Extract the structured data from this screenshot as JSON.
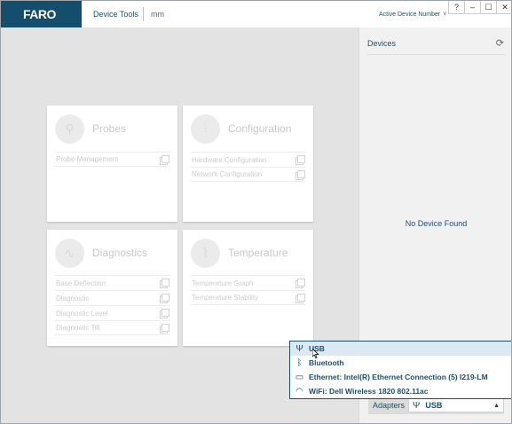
{
  "header": {
    "logo_text": "FARO",
    "nav_tools": "Device Tools",
    "nav_unit": "mm",
    "active_device_label": "Active Device Number",
    "window_buttons": [
      "?",
      "–",
      "☐",
      "✕"
    ]
  },
  "cards": [
    {
      "title": "Probes",
      "icon": "probe-icon",
      "items": [
        "Probe Management"
      ]
    },
    {
      "title": "Configuration",
      "icon": "sliders-icon",
      "items": [
        "Hardware Configuration",
        "Network Configuration"
      ]
    },
    {
      "title": "Diagnostics",
      "icon": "pulse-icon",
      "items": [
        "Base Deflection",
        "Diagnostic",
        "Diagnostic Level",
        "Diagnostic Tilt"
      ]
    },
    {
      "title": "Temperature",
      "icon": "thermometer-icon",
      "items": [
        "Temperature Graph",
        "Temperature Stability"
      ]
    }
  ],
  "devices": {
    "title": "Devices",
    "empty_text": "No Device Found",
    "adapters_label": "Adapters",
    "adapter_selected": "USB"
  },
  "adapter_options": [
    {
      "label": "USB",
      "icon": "usb-icon",
      "selected": true
    },
    {
      "label": "Bluetooth",
      "icon": "bluetooth-icon",
      "selected": false
    },
    {
      "label": "Ethernet: Intel(R) Ethernet Connection (5) I219-LM",
      "icon": "ethernet-icon",
      "selected": false
    },
    {
      "label": "WiFi: Dell Wireless 1820 802.11ac",
      "icon": "wifi-icon",
      "selected": false
    }
  ],
  "colors": {
    "brand": "#154e6c",
    "text": "#1d4f6b",
    "panel": "#f1f1f1",
    "main": "#e3e3e3"
  }
}
